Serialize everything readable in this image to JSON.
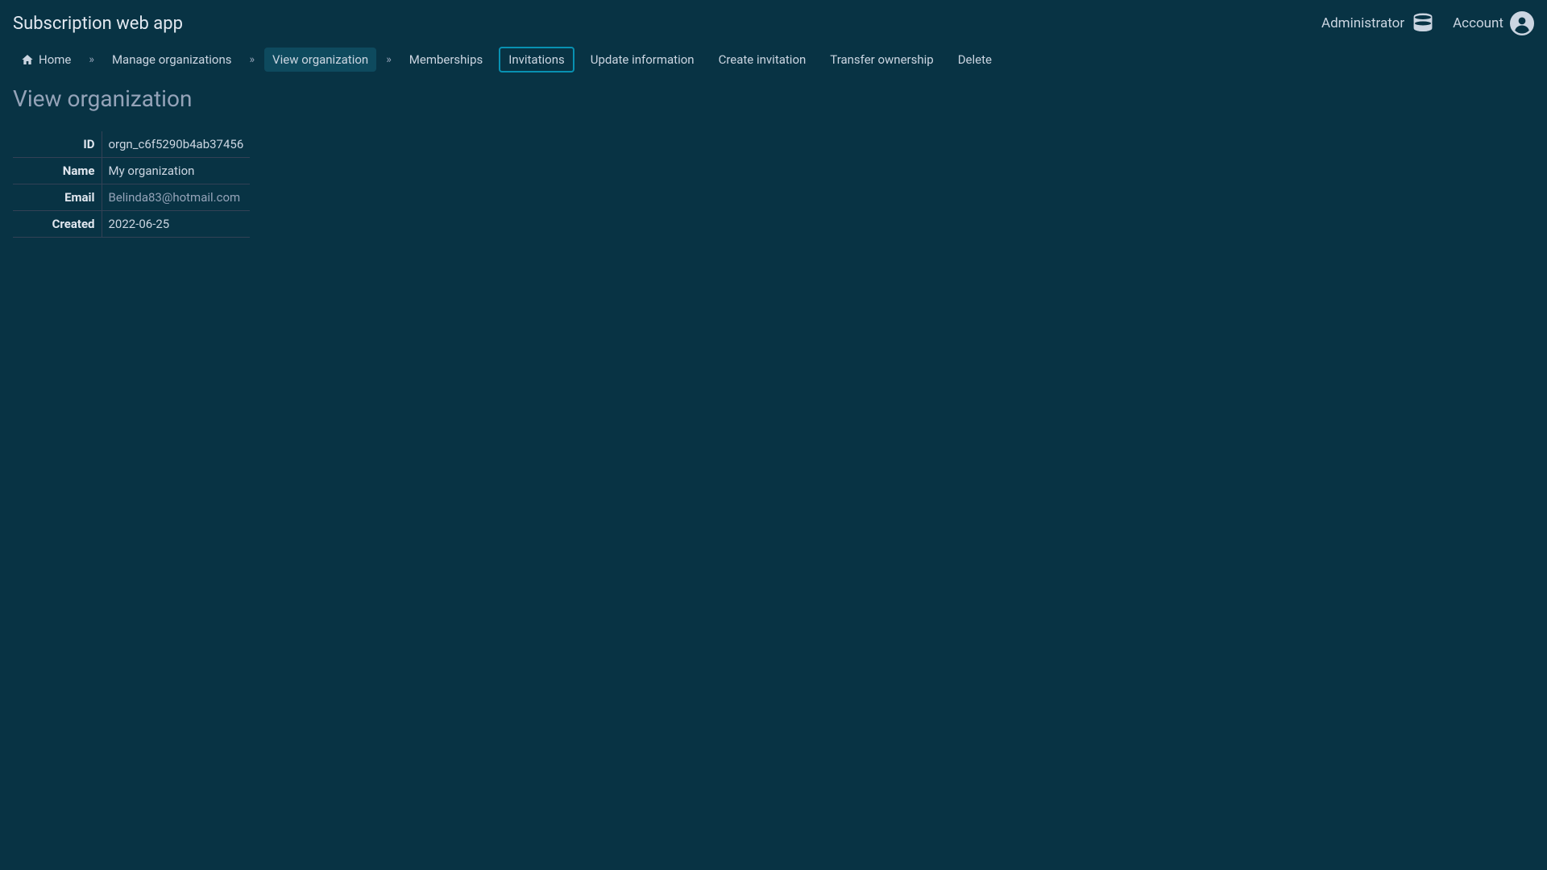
{
  "header": {
    "app_title": "Subscription web app",
    "links": {
      "administrator": "Administrator",
      "account": "Account"
    }
  },
  "nav": {
    "home": "Home",
    "manage_organizations": "Manage organizations",
    "view_organization": "View organization",
    "memberships": "Memberships",
    "invitations": "Invitations",
    "update_information": "Update information",
    "create_invitation": "Create invitation",
    "transfer_ownership": "Transfer ownership",
    "delete": "Delete",
    "separator": "»"
  },
  "page": {
    "title": "View organization"
  },
  "details": {
    "id_label": "ID",
    "id_value": "orgn_c6f5290b4ab37456",
    "name_label": "Name",
    "name_value": "My organization",
    "email_label": "Email",
    "email_value": "Belinda83@hotmail.com",
    "created_label": "Created",
    "created_value": "2022-06-25"
  }
}
